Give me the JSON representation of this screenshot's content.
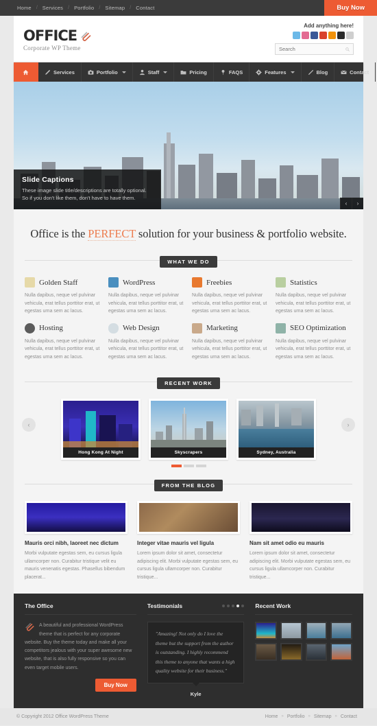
{
  "topbar": {
    "links": [
      "Home",
      "Services",
      "Portfolio",
      "Sitemap",
      "Contact"
    ],
    "separator": "/",
    "buy_now": "Buy Now",
    "accent_color": "#ed5b33"
  },
  "header": {
    "logo_text": "OFFICE",
    "logo_icon": "paperclip-icon",
    "tagline": "Corporate WP Theme",
    "widget_title": "Add anything here!",
    "socials": [
      {
        "name": "twitter-icon",
        "color": "#6cb9e8"
      },
      {
        "name": "instagram-icon",
        "color": "#e playerc"
      },
      {
        "name": "facebook-icon",
        "color": "#3b5998"
      },
      {
        "name": "youtube-icon",
        "color": "#d9422c"
      },
      {
        "name": "rss-icon",
        "color": "#f2920a"
      },
      {
        "name": "vimeo-icon",
        "color": "#2b2b2b"
      },
      {
        "name": "email-icon",
        "color": "#cfcfcf"
      }
    ],
    "search": {
      "placeholder": "Search",
      "value": ""
    }
  },
  "mainnav": [
    {
      "label": "",
      "icon": "home-icon",
      "active": true,
      "dropdown": false
    },
    {
      "label": "Services",
      "icon": "pencil-icon",
      "active": false,
      "dropdown": false
    },
    {
      "label": "Portfolio",
      "icon": "camera-icon",
      "active": false,
      "dropdown": true
    },
    {
      "label": "Staff",
      "icon": "user-icon",
      "active": false,
      "dropdown": true
    },
    {
      "label": "Pricing",
      "icon": "folder-icon",
      "active": false,
      "dropdown": false
    },
    {
      "label": "FAQS",
      "icon": "pin-icon",
      "active": false,
      "dropdown": false
    },
    {
      "label": "Features",
      "icon": "gear-icon",
      "active": false,
      "dropdown": true
    },
    {
      "label": "Blog",
      "icon": "pen-icon",
      "active": false,
      "dropdown": false
    },
    {
      "label": "Contact",
      "icon": "envelope-icon",
      "active": false,
      "dropdown": false
    }
  ],
  "hero": {
    "caption_title": "Slide Captions",
    "caption_line1": "These image slide title/descriptions are totally optional.",
    "caption_line2": "So if you don't like them, don't have to have them.",
    "prev": "‹",
    "next": "›"
  },
  "intro": {
    "before": "Office is the ",
    "highlight": "PERFECT",
    "after": " solution for your business & portfolio website."
  },
  "sections": {
    "what_we_do": "WHAT WE DO",
    "recent_work": "RECENT WORK",
    "from_the_blog": "FROM THE BLOG"
  },
  "services": {
    "body": "Nulla dapibus, neque vel pulvinar vehicula, erat tellus porttitor erat, ut egestas urna sem ac lacus.",
    "items": [
      {
        "title": "Golden Staff",
        "icon": "user-silhouette-icon",
        "color": "#e6d9a8"
      },
      {
        "title": "WordPress",
        "icon": "wordpress-icon",
        "color": "#4a8fbf"
      },
      {
        "title": "Freebies",
        "icon": "gift-icon",
        "color": "#e8792f"
      },
      {
        "title": "Statistics",
        "icon": "bar-chart-icon",
        "color": "#b9cfa0"
      },
      {
        "title": "Hosting",
        "icon": "server-icon",
        "color": "#5b5b5b"
      },
      {
        "title": "Web Design",
        "icon": "cloud-icon",
        "color": "#d4dde2"
      },
      {
        "title": "Marketing",
        "icon": "megaphone-icon",
        "color": "#c9a98a"
      },
      {
        "title": "SEO Optimization",
        "icon": "monitor-icon",
        "color": "#8fb3a8"
      }
    ]
  },
  "recent_work": {
    "items": [
      {
        "caption": "Hong Kong At Night",
        "theme": "night-blue"
      },
      {
        "caption": "Skyscrapers",
        "theme": "day-city"
      },
      {
        "caption": "Sydney, Australia",
        "theme": "harbour"
      }
    ],
    "prev": "‹",
    "next": "›",
    "pagination": {
      "count": 3,
      "active_index": 0
    }
  },
  "blog": {
    "posts": [
      {
        "title": "Mauris orci nibh, laoreet nec dictum",
        "excerpt": "Morbi vulputate egestas sem, eu cursus ligula ullamcorper non. Curabitur tristique velit eu mauris venenatis egestas. Phasellus bibendum placerat...",
        "theme": "night-blue"
      },
      {
        "title": "Integer vitae mauris vel ligula",
        "excerpt": "Lorem ipsum dolor sit amet, consectetur adipiscing elit. Morbi vulputate egestas sem, eu cursus ligula ullamcorper non. Curabitur tristique...",
        "theme": "crowd"
      },
      {
        "title": "Nam sit amet odio eu mauris",
        "excerpt": "Lorem ipsum dolor sit amet, consectetur adipiscing elit. Morbi vulputate egestas sem, eu cursus ligula ullamcorper non. Curabitur tristique...",
        "theme": "bridge-night"
      }
    ]
  },
  "footer": {
    "office": {
      "title": "The Office",
      "icon": "paperclip-icon",
      "body": "A beautiful and professional WordPress theme that is perfect for any corporate website. Buy the theme today and make all your competitors jealous with your super awesome new website, that is also fully responsive so you can even target mobile users.",
      "buy_now": "Buy Now"
    },
    "testimonials": {
      "title": "Testimonials",
      "quote": "\"Amazing! Not only do I love the theme but the support from the author is outstanding. I highly recommend this theme to anyone that wants a high quality website for their business.\"",
      "author": "Kyle",
      "pagination": {
        "count": 5,
        "active_index": 3
      }
    },
    "recent_work": {
      "title": "Recent Work",
      "thumbs": [
        "night-blue",
        "day-city",
        "harbour",
        "skyline",
        "arch",
        "night-water",
        "billboards",
        "golden-gate"
      ]
    }
  },
  "copyright": {
    "text": "© Copyright 2012 Office WordPress Theme",
    "links": [
      "Home",
      "Portfolio",
      "Sitemap",
      "Contact"
    ],
    "separator": "»"
  }
}
